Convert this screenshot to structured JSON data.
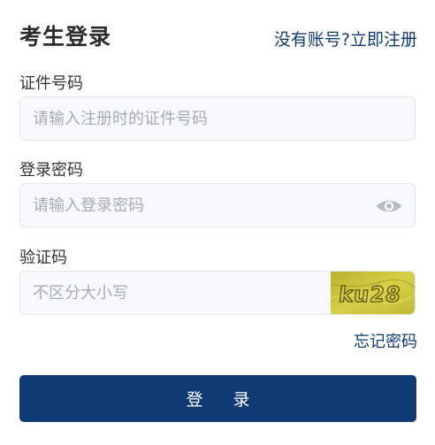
{
  "header": {
    "title": "考生登录",
    "register_link": "没有账号?立即注册"
  },
  "form": {
    "id_number": {
      "label": "证件号码",
      "placeholder": "请输入注册时的证件号码",
      "value": ""
    },
    "password": {
      "label": "登录密码",
      "placeholder": "请输入登录密码",
      "value": "",
      "toggle_icon": "eye-icon"
    },
    "captcha": {
      "label": "验证码",
      "placeholder": "不区分大小写",
      "value": "",
      "image_text": "ku28"
    },
    "forgot_password": "忘记密码",
    "submit_label": "登 录"
  },
  "colors": {
    "primary": "#0f3a73",
    "input_bg": "#f8f9fc",
    "input_border": "#e3e5ec",
    "placeholder": "#a9abb2",
    "captcha_bg": "#c9c23a"
  }
}
